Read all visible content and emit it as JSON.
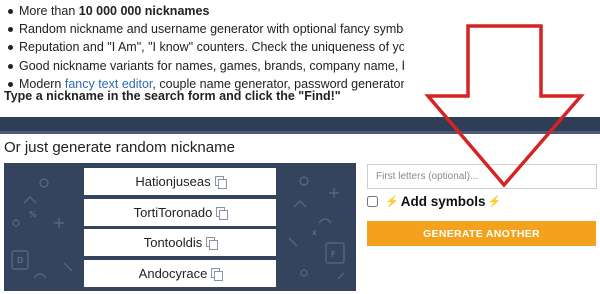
{
  "features": {
    "item1_prefix": "More than ",
    "item1_bold": "10 000 000 nicknames",
    "item2": "Random nickname and username generator with optional fancy symbols",
    "item3": "Reputation and \"I Am\", \"I know\" counters. Check the uniqueness of your",
    "item4": "Good nickname variants for names, games, brands, company name, bus",
    "item5_prefix": "Modern ",
    "item5_link": "fancy text editor",
    "item5_suffix": ", couple name generator, password generator..."
  },
  "instruction": "Type a nickname in the search form and click the \"Find!\"",
  "section_title": "Or just generate random nickname",
  "nicknames": [
    "Hationjuseas",
    "TortiToronado",
    "Tontooldis",
    "Andocyrace"
  ],
  "form": {
    "first_letters_placeholder": "First letters (optional)...",
    "bolt": "⚡",
    "add_symbols_label": "Add symbols",
    "generate_label": "GENERATE ANOTHER"
  },
  "colors": {
    "panel_bg": "#34445f",
    "button": "#f4a21d",
    "arrow": "#d42424",
    "link": "#2b6cb0"
  },
  "icons": [
    "copy-icon",
    "bolt-icon",
    "down-arrow-annotation"
  ]
}
